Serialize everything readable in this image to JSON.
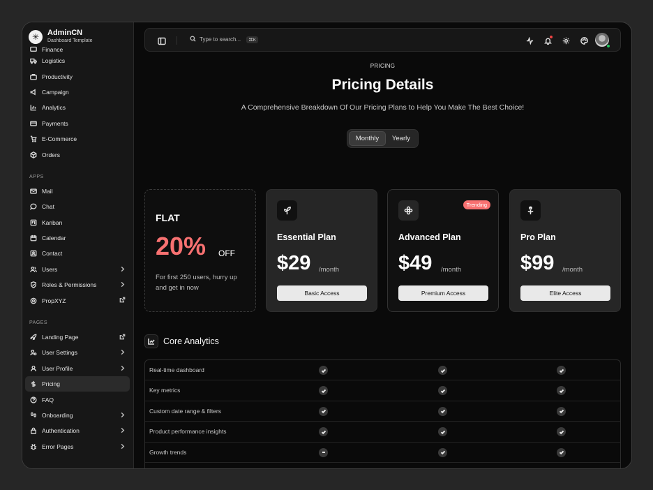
{
  "brand": {
    "name": "AdminCN",
    "subtitle": "Dashboard Template"
  },
  "sidebar": {
    "cut_item": "Finance",
    "top_items": [
      {
        "label": "Logistics",
        "icon": "truck-icon"
      },
      {
        "label": "Productivity",
        "icon": "briefcase-icon"
      },
      {
        "label": "Campaign",
        "icon": "megaphone-icon"
      },
      {
        "label": "Analytics",
        "icon": "bar-chart-icon"
      },
      {
        "label": "Payments",
        "icon": "credit-card-icon"
      },
      {
        "label": "E-Commerce",
        "icon": "cart-icon"
      },
      {
        "label": "Orders",
        "icon": "box-icon"
      }
    ],
    "apps_label": "APPS",
    "app_items": [
      {
        "label": "Mail",
        "icon": "mail-icon"
      },
      {
        "label": "Chat",
        "icon": "chat-icon"
      },
      {
        "label": "Kanban",
        "icon": "kanban-icon"
      },
      {
        "label": "Calendar",
        "icon": "calendar-icon"
      },
      {
        "label": "Contact",
        "icon": "contact-icon"
      },
      {
        "label": "Users",
        "icon": "users-icon"
      },
      {
        "label": "Roles & Permissions",
        "icon": "shield-icon"
      },
      {
        "label": "PropXYZ",
        "icon": "prop-icon"
      }
    ],
    "pages_label": "PAGES",
    "page_items": [
      {
        "label": "Landing Page",
        "icon": "rocket-icon"
      },
      {
        "label": "User Settings",
        "icon": "user-settings-icon"
      },
      {
        "label": "User Profile",
        "icon": "user-icon"
      },
      {
        "label": "Pricing",
        "icon": "dollar-icon"
      },
      {
        "label": "FAQ",
        "icon": "help-icon"
      },
      {
        "label": "Onboarding",
        "icon": "footprints-icon"
      },
      {
        "label": "Authentication",
        "icon": "lock-icon"
      },
      {
        "label": "Error Pages",
        "icon": "bug-icon"
      }
    ]
  },
  "topbar": {
    "search_placeholder": "Type to search...",
    "search_shortcut": "⌘K"
  },
  "header": {
    "eyebrow": "PRICING",
    "title": "Pricing Details",
    "subtitle": "A Comprehensive Breakdown Of Our Pricing Plans to Help You Make The Best Choice!"
  },
  "billing_toggle": {
    "options": [
      "Monthly",
      "Yearly"
    ],
    "selected": "Monthly"
  },
  "promo": {
    "label": "FLAT",
    "percent": "20%",
    "suffix": "OFF",
    "description": "For first 250 users, hurry up and get in now"
  },
  "plans": [
    {
      "name": "Essential Plan",
      "price": "$29",
      "period": "/month",
      "button": "Basic Access",
      "badge": ""
    },
    {
      "name": "Advanced Plan",
      "price": "$49",
      "period": "/month",
      "button": "Premium Access",
      "badge": "Trending"
    },
    {
      "name": "Pro Plan",
      "price": "$99",
      "period": "/month",
      "button": "Elite Access",
      "badge": ""
    }
  ],
  "features_section": {
    "title": "Core Analytics",
    "rows": [
      {
        "feature": "Real-time dashboard",
        "values": [
          "check",
          "check",
          "check"
        ]
      },
      {
        "feature": "Key metrics",
        "values": [
          "check",
          "check",
          "check"
        ]
      },
      {
        "feature": "Custom date range & filters",
        "values": [
          "check",
          "check",
          "check"
        ]
      },
      {
        "feature": "Product performance insights",
        "values": [
          "check",
          "check",
          "check"
        ]
      },
      {
        "feature": "Growth trends",
        "values": [
          "minus",
          "check",
          "check"
        ]
      }
    ]
  },
  "colors": {
    "accent": "#f87171",
    "background": "#0a0a0a",
    "sidebar": "#171717",
    "card": "#262626",
    "online": "#22c55e"
  }
}
